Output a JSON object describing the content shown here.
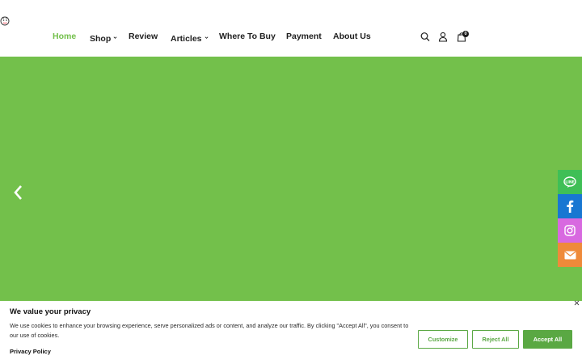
{
  "nav": {
    "items": [
      {
        "label": "Home"
      },
      {
        "label": "Shop"
      },
      {
        "label": "Review"
      },
      {
        "label": "Articles"
      },
      {
        "label": "Where To Buy"
      },
      {
        "label": "Payment"
      },
      {
        "label": "About Us"
      }
    ]
  },
  "header": {
    "cart_count": "0",
    "icons": [
      "search-icon",
      "account-icon",
      "shopping-bag-icon"
    ]
  },
  "colors": {
    "accent": "#73c04b",
    "hero_bg": "#73c04b",
    "button_green": "#5aa843",
    "line": "#3fbf56",
    "facebook": "#1877d2",
    "instagram": "#d869e0",
    "email": "#ef8a3a"
  },
  "social": [
    "line-icon",
    "facebook-icon",
    "instagram-icon",
    "email-icon"
  ],
  "cookie": {
    "title": "We value your privacy",
    "text": "We use cookies to enhance your browsing experience, serve personalized ads or content, and analyze our traffic. By clicking \"Accept All\", you consent to our use of cookies.",
    "policy_link": "Privacy Policy",
    "customize": "Customize",
    "reject": "Reject All",
    "accept": "Accept All"
  }
}
